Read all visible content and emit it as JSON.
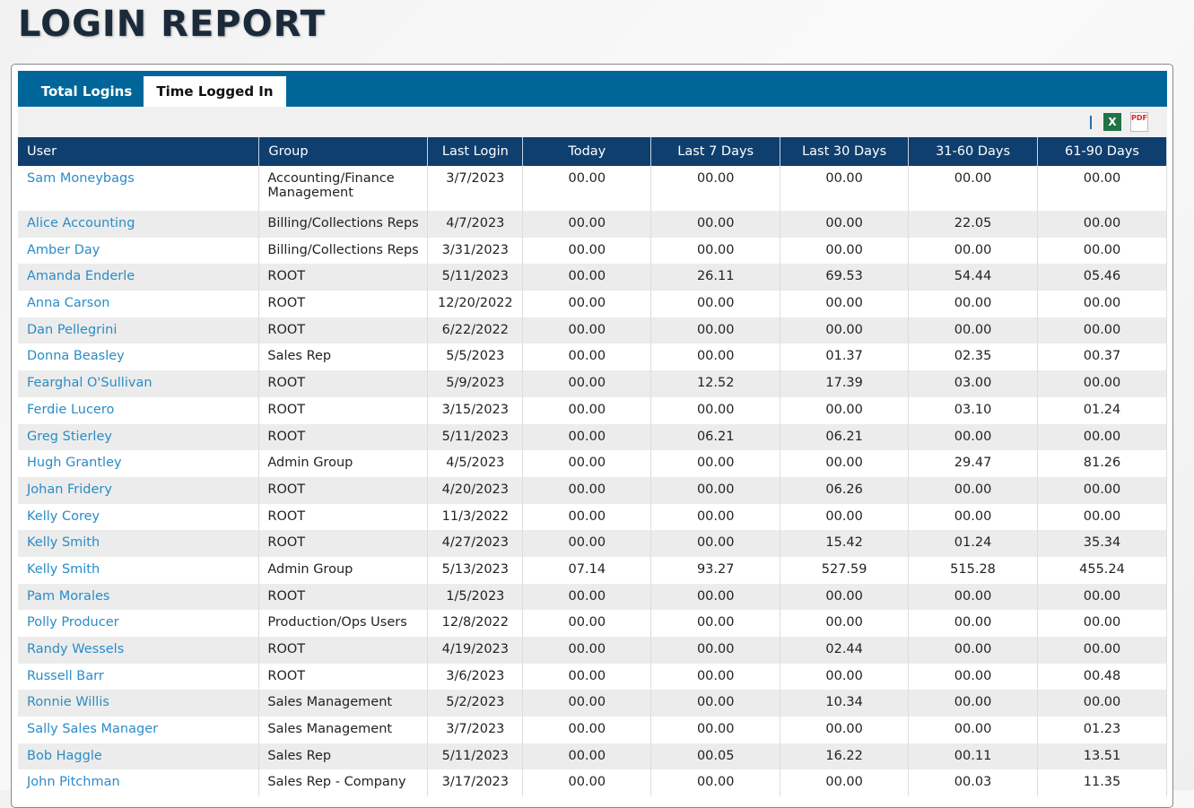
{
  "title": "LOGIN REPORT",
  "tabs": [
    {
      "label": "Total Logins",
      "active": false
    },
    {
      "label": "Time Logged In",
      "active": true
    }
  ],
  "toolbar": {
    "excel_icon": "excel-icon",
    "pdf_icon": "pdf-icon",
    "excel_text": "X",
    "pdf_text": "PDF"
  },
  "columns": [
    "User",
    "Group",
    "Last Login",
    "Today",
    "Last 7 Days",
    "Last 30 Days",
    "31-60 Days",
    "61-90 Days"
  ],
  "rows": [
    [
      "Sam Moneybags",
      "Accounting/Finance Management",
      "3/7/2023",
      "00.00",
      "00.00",
      "00.00",
      "00.00",
      "00.00"
    ],
    [
      "Alice Accounting",
      "Billing/Collections Reps",
      "4/7/2023",
      "00.00",
      "00.00",
      "00.00",
      "22.05",
      "00.00"
    ],
    [
      "Amber Day",
      "Billing/Collections Reps",
      "3/31/2023",
      "00.00",
      "00.00",
      "00.00",
      "00.00",
      "00.00"
    ],
    [
      "Amanda Enderle",
      "ROOT",
      "5/11/2023",
      "00.00",
      "26.11",
      "69.53",
      "54.44",
      "05.46"
    ],
    [
      "Anna Carson",
      "ROOT",
      "12/20/2022",
      "00.00",
      "00.00",
      "00.00",
      "00.00",
      "00.00"
    ],
    [
      "Dan Pellegrini",
      "ROOT",
      "6/22/2022",
      "00.00",
      "00.00",
      "00.00",
      "00.00",
      "00.00"
    ],
    [
      "Donna Beasley",
      "Sales Rep",
      "5/5/2023",
      "00.00",
      "00.00",
      "01.37",
      "02.35",
      "00.37"
    ],
    [
      "Fearghal O'Sullivan",
      "ROOT",
      "5/9/2023",
      "00.00",
      "12.52",
      "17.39",
      "03.00",
      "00.00"
    ],
    [
      "Ferdie Lucero",
      "ROOT",
      "3/15/2023",
      "00.00",
      "00.00",
      "00.00",
      "03.10",
      "01.24"
    ],
    [
      "Greg Stierley",
      "ROOT",
      "5/11/2023",
      "00.00",
      "06.21",
      "06.21",
      "00.00",
      "00.00"
    ],
    [
      "Hugh Grantley",
      "Admin Group",
      "4/5/2023",
      "00.00",
      "00.00",
      "00.00",
      "29.47",
      "81.26"
    ],
    [
      "Johan Fridery",
      "ROOT",
      "4/20/2023",
      "00.00",
      "00.00",
      "06.26",
      "00.00",
      "00.00"
    ],
    [
      "Kelly Corey",
      "ROOT",
      "11/3/2022",
      "00.00",
      "00.00",
      "00.00",
      "00.00",
      "00.00"
    ],
    [
      "Kelly Smith",
      "ROOT",
      "4/27/2023",
      "00.00",
      "00.00",
      "15.42",
      "01.24",
      "35.34"
    ],
    [
      "Kelly Smith",
      "Admin Group",
      "5/13/2023",
      "07.14",
      "93.27",
      "527.59",
      "515.28",
      "455.24"
    ],
    [
      "Pam Morales",
      "ROOT",
      "1/5/2023",
      "00.00",
      "00.00",
      "00.00",
      "00.00",
      "00.00"
    ],
    [
      "Polly Producer",
      "Production/Ops Users",
      "12/8/2022",
      "00.00",
      "00.00",
      "00.00",
      "00.00",
      "00.00"
    ],
    [
      "Randy Wessels",
      "ROOT",
      "4/19/2023",
      "00.00",
      "00.00",
      "02.44",
      "00.00",
      "00.00"
    ],
    [
      "Russell Barr",
      "ROOT",
      "3/6/2023",
      "00.00",
      "00.00",
      "00.00",
      "00.00",
      "00.48"
    ],
    [
      "Ronnie Willis",
      "Sales Management",
      "5/2/2023",
      "00.00",
      "00.00",
      "10.34",
      "00.00",
      "00.00"
    ],
    [
      "Sally Sales Manager",
      "Sales Management",
      "3/7/2023",
      "00.00",
      "00.00",
      "00.00",
      "00.00",
      "01.23"
    ],
    [
      "Bob Haggle",
      "Sales Rep",
      "5/11/2023",
      "00.00",
      "00.05",
      "16.22",
      "00.11",
      "13.51"
    ],
    [
      "John Pitchman",
      "Sales Rep - Company",
      "3/17/2023",
      "00.00",
      "00.00",
      "00.00",
      "00.03",
      "11.35"
    ]
  ]
}
